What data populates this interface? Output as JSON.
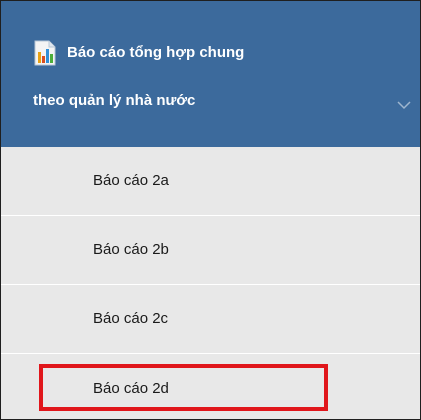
{
  "menu": {
    "title_line1": "Báo cáo tổng hợp chung",
    "title_line2": "theo quản lý nhà nước",
    "icon": "report-chart-icon",
    "chevron_icon": "chevron-down-icon",
    "header_color": "#3c6a9c"
  },
  "items": [
    {
      "label": "Báo cáo 2a"
    },
    {
      "label": "Báo cáo 2b"
    },
    {
      "label": "Báo cáo 2c"
    },
    {
      "label": "Báo cáo 2d",
      "highlighted": true
    }
  ],
  "colors": {
    "item_background": "#e8e8e8",
    "highlight_border": "#e0161b"
  }
}
